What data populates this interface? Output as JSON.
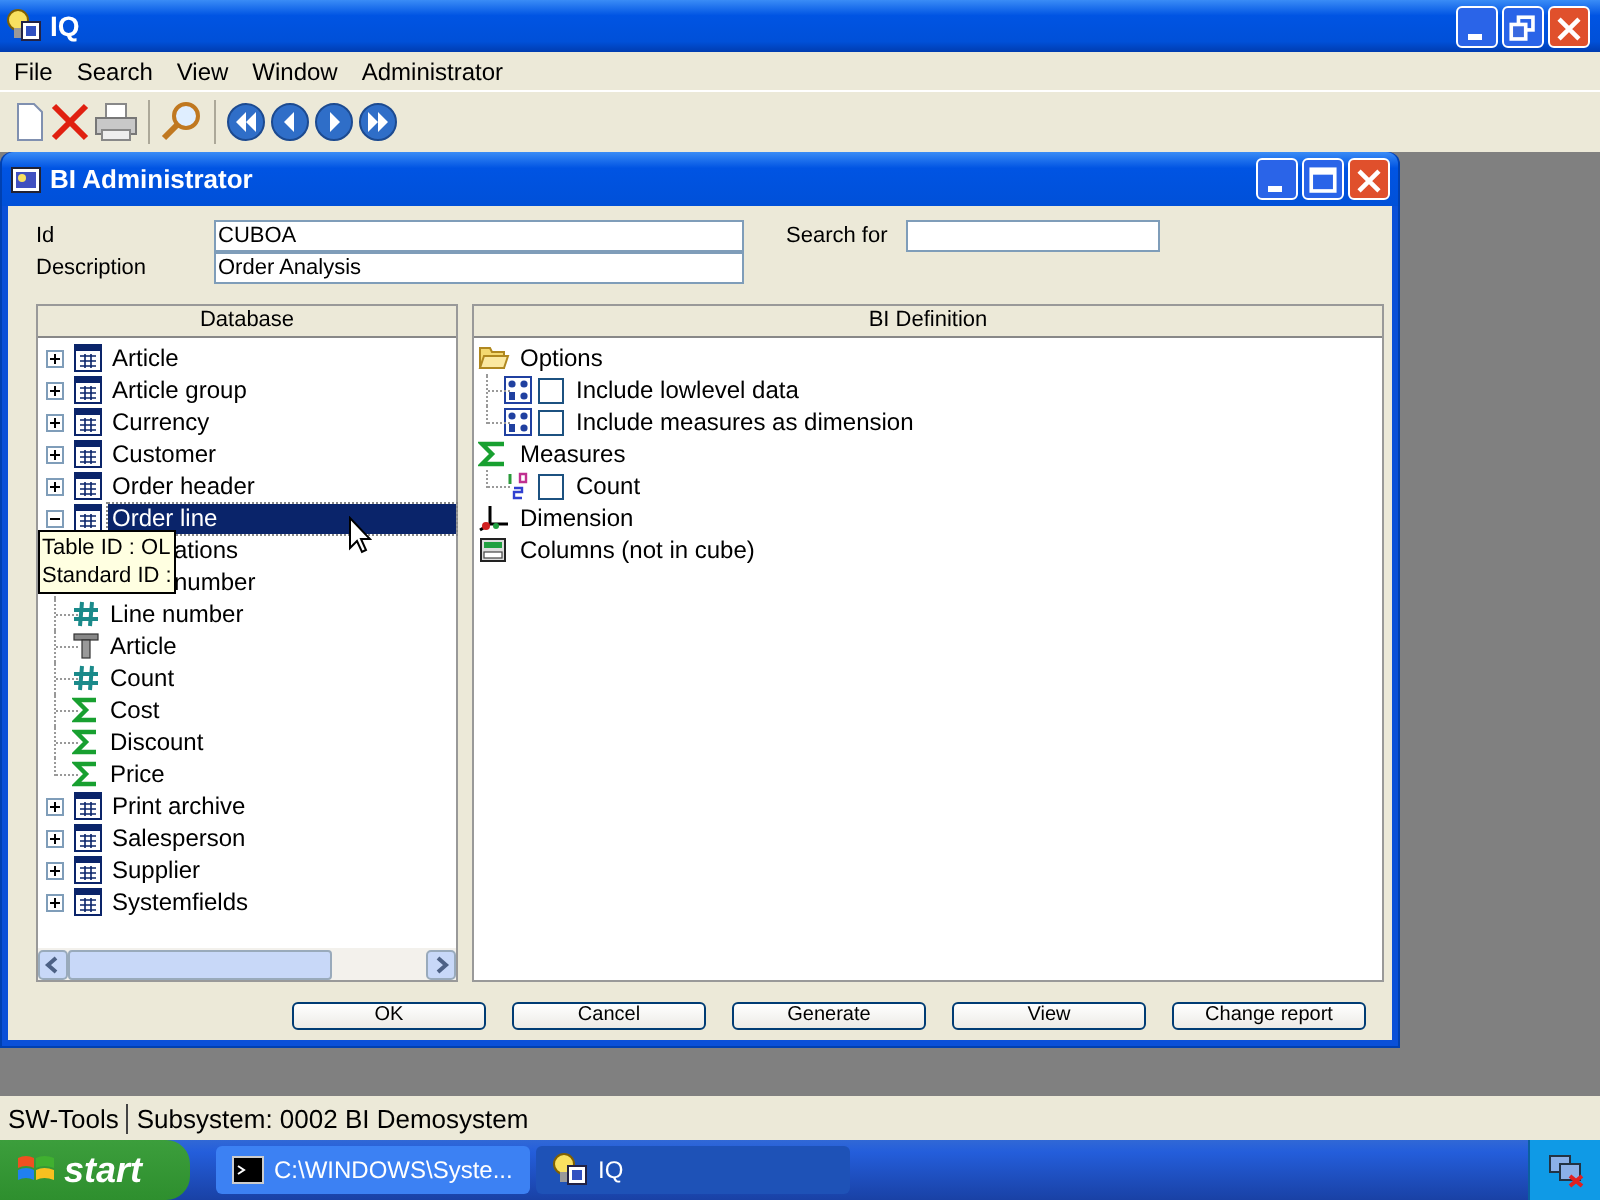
{
  "window": {
    "title": "IQ"
  },
  "menu": [
    "File",
    "Search",
    "View",
    "Window",
    "Administrator"
  ],
  "child_window": {
    "title": "BI Administrator",
    "fields": [
      {
        "label": "Id",
        "value": "CUBOA"
      },
      {
        "label": "Description",
        "value": "Order Analysis"
      }
    ],
    "search": {
      "label": "Search for"
    },
    "database": {
      "header": "Database",
      "items": [
        {
          "label": "Article",
          "expanded": false,
          "selected": false
        },
        {
          "label": "Article group",
          "expanded": false,
          "selected": false
        },
        {
          "label": "Currency",
          "expanded": false,
          "selected": false
        },
        {
          "label": "Customer",
          "expanded": false,
          "selected": false
        },
        {
          "label": "Order header",
          "expanded": false,
          "selected": false
        },
        {
          "label": "Order line",
          "expanded": true,
          "selected": true,
          "children": [
            {
              "label": "ations",
              "kind": "covered"
            },
            {
              "label": "number",
              "kind": "covered"
            },
            {
              "label": "Line number",
              "kind": "number"
            },
            {
              "label": "Article",
              "kind": "text"
            },
            {
              "label": "Count",
              "kind": "number"
            },
            {
              "label": "Cost",
              "kind": "sum"
            },
            {
              "label": "Discount",
              "kind": "sum"
            },
            {
              "label": "Price",
              "kind": "sum"
            }
          ]
        },
        {
          "label": "Print archive",
          "expanded": false,
          "selected": false
        },
        {
          "label": "Salesperson",
          "expanded": false,
          "selected": false
        },
        {
          "label": "Supplier",
          "expanded": false,
          "selected": false
        },
        {
          "label": "Systemfields",
          "expanded": false,
          "selected": false
        }
      ],
      "tooltip": [
        "Table ID : OL",
        "Standard ID :"
      ]
    },
    "definition": {
      "header": "BI Definition",
      "items": [
        {
          "label": "Options",
          "kind": "folder",
          "children": [
            {
              "label": "Include lowlevel data",
              "kind": "option",
              "checked": false
            },
            {
              "label": "Include measures as dimension",
              "kind": "option",
              "checked": false
            }
          ]
        },
        {
          "label": "Measures",
          "kind": "sum",
          "children": [
            {
              "label": "Count",
              "kind": "count",
              "checked": false
            }
          ]
        },
        {
          "label": "Dimension",
          "kind": "axes"
        },
        {
          "label": "Columns (not in cube)",
          "kind": "columns"
        }
      ]
    },
    "buttons": [
      "OK",
      "Cancel",
      "Generate",
      "View",
      "Change report"
    ]
  },
  "status_bar": [
    "SW-Tools",
    "Subsystem: 0002 BI Demosystem"
  ],
  "taskbar": {
    "start": "start",
    "tasks": [
      {
        "label": "C:\\WINDOWS\\Syste...",
        "kind": "console",
        "selected": false
      },
      {
        "label": "IQ",
        "kind": "app",
        "selected": true
      }
    ]
  }
}
